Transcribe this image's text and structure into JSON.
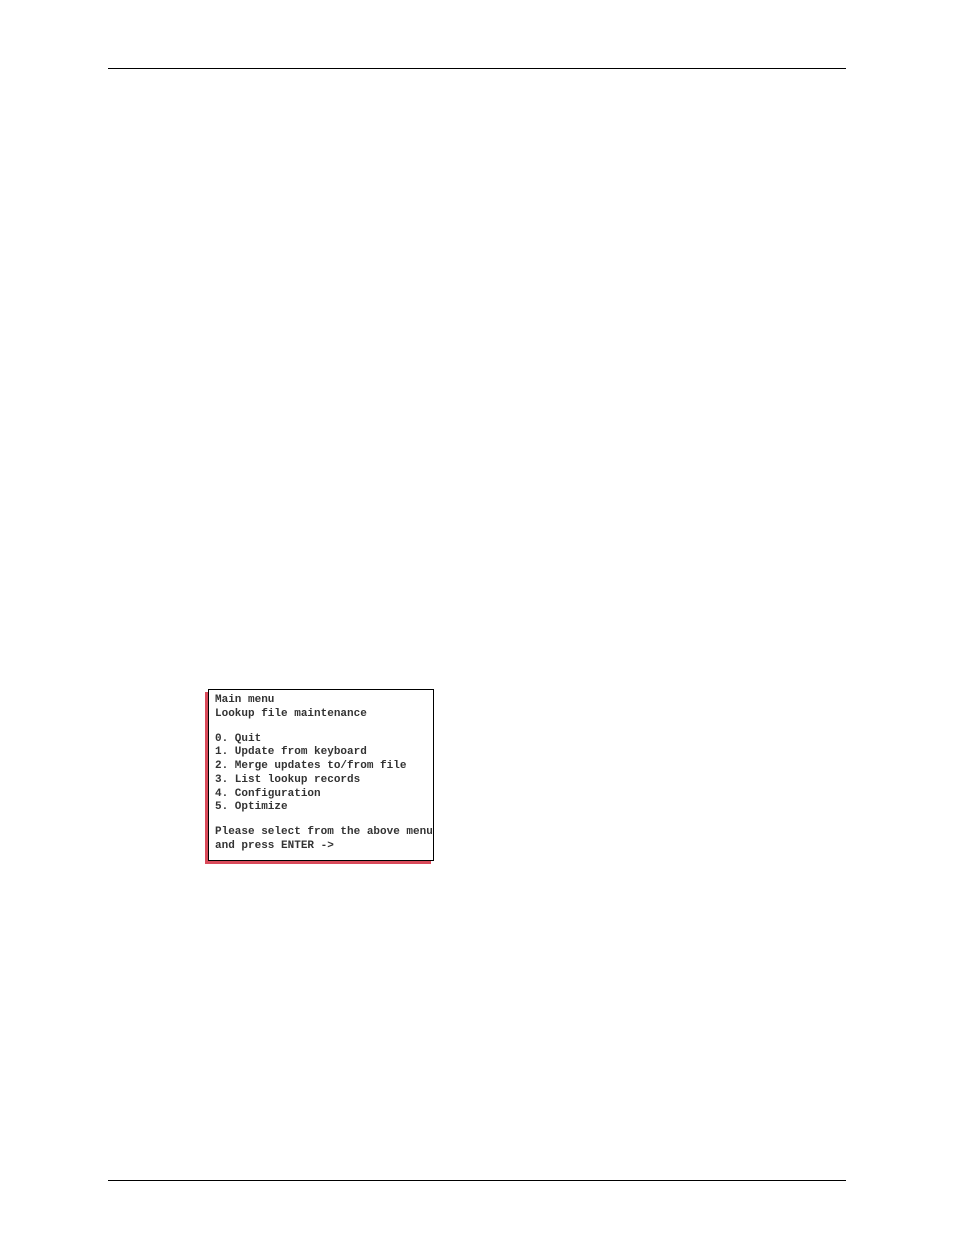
{
  "menu": {
    "title": "Main menu",
    "subtitle": "Lookup file maintenance",
    "items": [
      "0. Quit",
      "1. Update from keyboard",
      "2. Merge updates to/from file",
      "3. List lookup records",
      "4. Configuration",
      "5. Optimize"
    ],
    "prompt_line1": "Please select from the above menu",
    "prompt_line2": "and press ENTER ->"
  }
}
